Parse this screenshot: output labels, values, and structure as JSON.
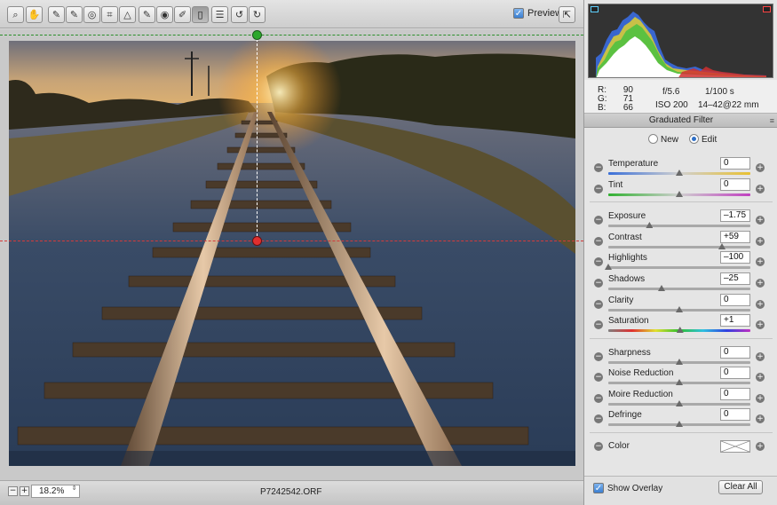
{
  "toolbar": {
    "tools": [
      {
        "name": "zoom-tool",
        "glyph": "⌕"
      },
      {
        "name": "hand-tool",
        "glyph": "✋"
      },
      {
        "name": "white-balance-tool",
        "glyph": "✎"
      },
      {
        "name": "color-sampler-tool",
        "glyph": "✎"
      },
      {
        "name": "targeted-adjustment-tool",
        "glyph": "◎"
      },
      {
        "name": "crop-tool",
        "glyph": "⌗"
      },
      {
        "name": "straighten-tool",
        "glyph": "△"
      },
      {
        "name": "spot-removal-tool",
        "glyph": "✎"
      },
      {
        "name": "red-eye-tool",
        "glyph": "◉"
      },
      {
        "name": "adjustment-brush-tool",
        "glyph": "✐"
      },
      {
        "name": "graduated-filter-tool",
        "glyph": "▯"
      },
      {
        "name": "preferences-tool",
        "glyph": "☰"
      },
      {
        "name": "rotate-left-tool",
        "glyph": "↺"
      },
      {
        "name": "rotate-right-tool",
        "glyph": "↻"
      }
    ],
    "preview_label": "Preview",
    "preview_checked": true
  },
  "statusbar": {
    "zoom": "18.2%",
    "filename": "P7242542.ORF"
  },
  "readout": {
    "r_label": "R:",
    "r_value": "90",
    "g_label": "G:",
    "g_value": "71",
    "b_label": "B:",
    "b_value": "66",
    "aperture": "f/5.6",
    "shutter": "1/100 s",
    "iso": "ISO 200",
    "lens": "14–42@22 mm"
  },
  "panel": {
    "title": "Graduated Filter",
    "mode_new": "New",
    "mode_edit": "Edit",
    "active_mode": "Edit",
    "sliders": [
      {
        "key": "temperature",
        "label": "Temperature",
        "value": "0",
        "pos": 0.5,
        "track": "temp"
      },
      {
        "key": "tint",
        "label": "Tint",
        "value": "0",
        "pos": 0.5,
        "track": "tint"
      },
      {
        "key": "exposure",
        "label": "Exposure",
        "value": "–1.75",
        "pos": 0.29,
        "track": "gray"
      },
      {
        "key": "contrast",
        "label": "Contrast",
        "value": "+59",
        "pos": 0.8,
        "track": "gray"
      },
      {
        "key": "highlights",
        "label": "Highlights",
        "value": "–100",
        "pos": 0.0,
        "track": "gray"
      },
      {
        "key": "shadows",
        "label": "Shadows",
        "value": "–25",
        "pos": 0.375,
        "track": "gray"
      },
      {
        "key": "clarity",
        "label": "Clarity",
        "value": "0",
        "pos": 0.5,
        "track": "gray"
      },
      {
        "key": "saturation",
        "label": "Saturation",
        "value": "+1",
        "pos": 0.505,
        "track": "sat"
      },
      {
        "key": "sharpness",
        "label": "Sharpness",
        "value": "0",
        "pos": 0.5,
        "track": "gray"
      },
      {
        "key": "noise_reduction",
        "label": "Noise Reduction",
        "value": "0",
        "pos": 0.5,
        "track": "gray"
      },
      {
        "key": "moire_reduction",
        "label": "Moire Reduction",
        "value": "0",
        "pos": 0.5,
        "track": "gray"
      },
      {
        "key": "defringe",
        "label": "Defringe",
        "value": "0",
        "pos": 0.5,
        "track": "gray"
      }
    ],
    "color_label": "Color",
    "show_overlay_label": "Show Overlay",
    "show_overlay_checked": true,
    "clear_all_label": "Clear All"
  },
  "icons": {
    "zoom_out": "−",
    "zoom_in": "+",
    "zoom_dropdown": "⇕",
    "fullscreen": "⇱",
    "minus": "−",
    "plus": "+",
    "checkmark": "✓",
    "panel_menu": "≡"
  },
  "colors": {
    "accent_blue": "#3b7fd1",
    "guide_green": "#2ca82c",
    "guide_red": "#e12f2f"
  }
}
